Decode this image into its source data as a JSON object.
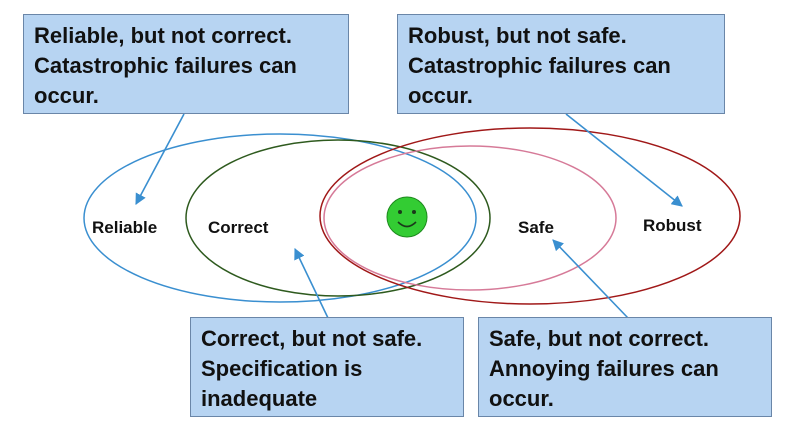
{
  "callouts": {
    "reliable_not_correct": {
      "lines": [
        "Reliable, but not correct.",
        "Catastrophic failures can",
        "occur."
      ]
    },
    "robust_not_safe": {
      "lines": [
        "Robust, but not safe.",
        "Catastrophic failures can",
        "occur."
      ]
    },
    "correct_not_safe": {
      "lines": [
        "Correct, but not safe.",
        "Specification is",
        "inadequate"
      ]
    },
    "safe_not_correct": {
      "lines": [
        "Safe, but not correct.",
        "Annoying failures can",
        "occur."
      ]
    }
  },
  "sets": {
    "reliable": {
      "label": "Reliable",
      "color": "#3a8fd0"
    },
    "correct": {
      "label": "Correct",
      "color": "#2e5a1e"
    },
    "safe": {
      "label": "Safe",
      "color": "#d67a98"
    },
    "robust": {
      "label": "Robust",
      "color": "#a01818"
    }
  },
  "smiley": {
    "icon": "smiley-face-icon",
    "color": "#33cc33"
  },
  "colors": {
    "callout_fill": "#b7d4f2",
    "callout_border": "#6a86a8",
    "arrow": "#3a8fd0"
  }
}
